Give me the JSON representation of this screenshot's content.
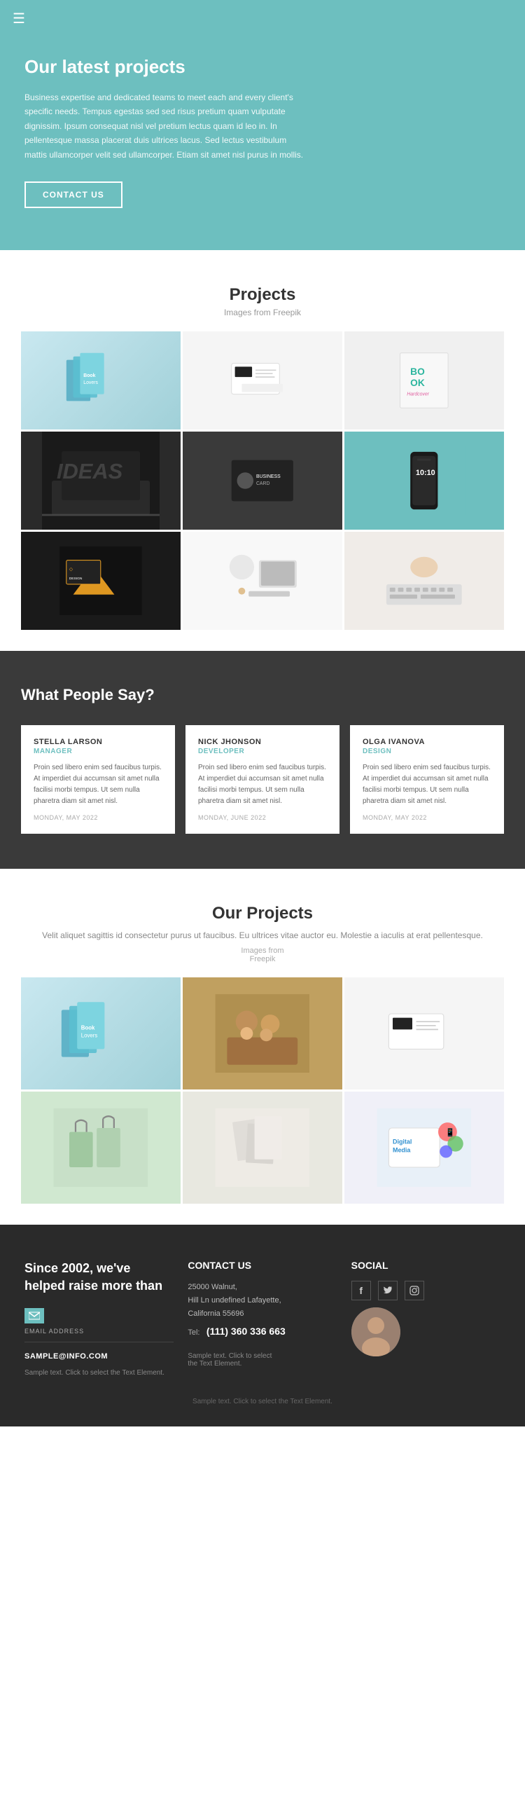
{
  "header": {
    "hamburger_label": "☰",
    "title": "Our latest projects",
    "description": "Business expertise and dedicated teams to meet each and every client's specific needs. Tempus egestas sed sed risus pretium quam vulputate dignissim. Ipsum consequat nisl vel pretium lectus quam id leo in. In pellentesque massa placerat duis ultrices lacus. Sed lectus vestibulum mattis ullamcorper velit sed ullamcorper. Etiam sit amet nisl purus in mollis.",
    "contact_btn": "CONTACT US"
  },
  "projects_section": {
    "title": "Projects",
    "subtitle": "Images from Freepik",
    "grid": [
      {
        "id": "books-teal",
        "type": "books-teal"
      },
      {
        "id": "business-card-white",
        "type": "business-card-white"
      },
      {
        "id": "book-cover",
        "type": "book-cover"
      },
      {
        "id": "ideas-laptop",
        "type": "ideas-laptop"
      },
      {
        "id": "card-dark",
        "type": "card-dark"
      },
      {
        "id": "phone-green",
        "type": "phone-green"
      },
      {
        "id": "design-card",
        "type": "design-card"
      },
      {
        "id": "desk-lamp",
        "type": "desk-lamp"
      },
      {
        "id": "keyboard-hands",
        "type": "keyboard-hands"
      }
    ]
  },
  "testimonials": {
    "title": "What People Say?",
    "items": [
      {
        "name": "STELLA LARSON",
        "role": "MANAGER",
        "text": "Proin sed libero enim sed faucibus turpis. At imperdiet dui accumsan sit amet nulla facilisi morbi tempus. Ut sem nulla pharetra diam sit amet nisl.",
        "date": "MONDAY, MAY 2022"
      },
      {
        "name": "NICK JHONSON",
        "role": "DEVELOPER",
        "text": "Proin sed libero enim sed faucibus turpis. At imperdiet dui accumsan sit amet nulla facilisi morbi tempus. Ut sem nulla pharetra diam sit amet nisl.",
        "date": "MONDAY, JUNE 2022"
      },
      {
        "name": "OLGA IVANOVA",
        "role": "DESIGN",
        "text": "Proin sed libero enim sed faucibus turpis. At imperdiet dui accumsan sit amet nulla facilisi morbi tempus. Ut sem nulla pharetra diam sit amet nisl.",
        "date": "MONDAY, MAY 2022"
      }
    ]
  },
  "our_projects": {
    "title": "Our Projects",
    "description": "Velit aliquet sagittis id consectetur purus ut faucibus. Eu ultrices vitae auctor eu. Molestie a iaculis at erat pellentesque.",
    "img_credit": "Images from\nFreepik",
    "grid": [
      {
        "id": "op-books",
        "type": "books-teal"
      },
      {
        "id": "op-team",
        "type": "team-meeting"
      },
      {
        "id": "op-business-card",
        "type": "business-card-white"
      },
      {
        "id": "op-bags",
        "type": "green-bags"
      },
      {
        "id": "op-paper",
        "type": "white-paper"
      },
      {
        "id": "op-digital",
        "type": "digital-media"
      }
    ]
  },
  "footer": {
    "tagline": "Since 2002, we've helped raise more than",
    "email_label": "EMAIL ADDRESS",
    "email": "SAMPLE@INFO.COM",
    "contact_title": "CONTACT US",
    "address": "25000 Walnut,\nHill Ln undefined Lafayette,\nCalifornia 55696",
    "tel_label": "Tel:",
    "phone": "(111) 360 336 663",
    "social_title": "SOCIAL",
    "social_icons": [
      "f",
      "t",
      "in"
    ],
    "sample_text_1": "Sample text. Click to select the Text Element.",
    "sample_text_2": "Sample text. Click to select\nthe Text Element.",
    "bottom_text": "Sample text. Click to select the Text Element."
  }
}
